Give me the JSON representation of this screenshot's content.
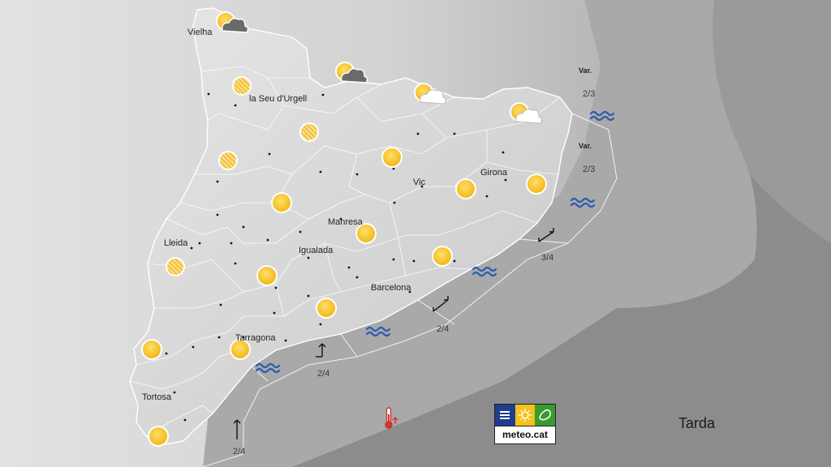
{
  "map": {
    "panel_label": "Tarda",
    "logo_text": "meteo.cat",
    "cities": [
      {
        "name": "Vielha"
      },
      {
        "name": "la Seu d'Urgell"
      },
      {
        "name": "Lleida"
      },
      {
        "name": "Manresa"
      },
      {
        "name": "Vic"
      },
      {
        "name": "Girona"
      },
      {
        "name": "Igualada"
      },
      {
        "name": "Barcelona"
      },
      {
        "name": "Tarragona"
      },
      {
        "name": "Tortosa"
      }
    ],
    "wind_labels": [
      "Var.",
      "Var."
    ],
    "sea_states": [
      "2/3",
      "2/3",
      "3/4",
      "2/4",
      "2/4",
      "2/4"
    ],
    "forecast_icons": [
      "partly-cloudy-icon",
      "sun-icon",
      "sun-haze-icon",
      "wave-icon",
      "wind-arrow-icon",
      "thermometer-icon"
    ],
    "colors": {
      "sun": "#f7c01c",
      "sun_edge": "#c79a12",
      "wave": "#2d5bb0",
      "sea": "#8f8f8f",
      "land": "#d9d9d9"
    }
  }
}
